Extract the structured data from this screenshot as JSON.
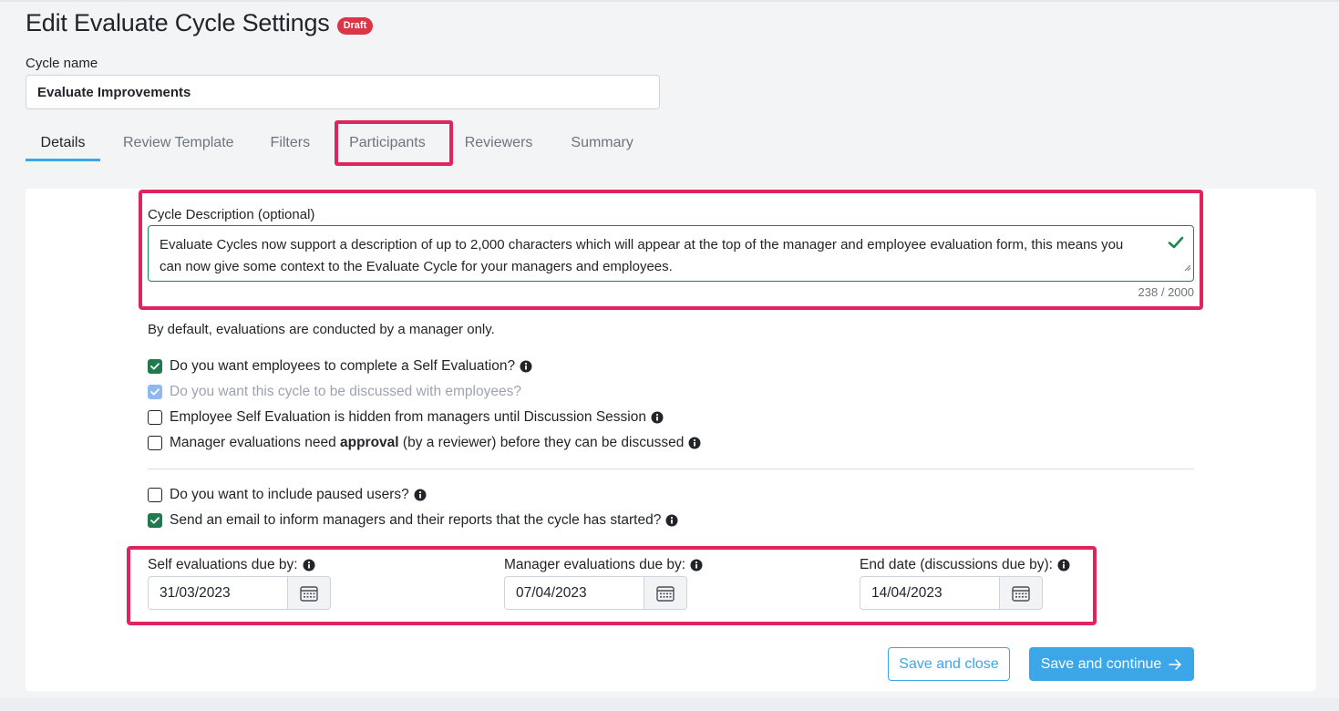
{
  "page": {
    "title": "Edit Evaluate Cycle Settings",
    "status_badge": "Draft"
  },
  "cycle_name": {
    "label": "Cycle name",
    "value": "Evaluate Improvements"
  },
  "tabs": [
    {
      "label": "Details",
      "active": true
    },
    {
      "label": "Review Template",
      "active": false
    },
    {
      "label": "Filters",
      "active": false
    },
    {
      "label": "Participants",
      "active": false,
      "highlighted": true
    },
    {
      "label": "Reviewers",
      "active": false
    },
    {
      "label": "Summary",
      "active": false
    }
  ],
  "description": {
    "label": "Cycle Description (optional)",
    "value": "Evaluate Cycles now support a description of up to 2,000 characters which will appear at the top of the manager and employee evaluation form, this means you can now give some context to the Evaluate Cycle for your managers and employees.",
    "counter": "238 / 2000",
    "valid_icon": "check-icon"
  },
  "intro_text": "By default, evaluations are conducted by a manager only.",
  "options": [
    {
      "label": "Do you want employees to complete a Self Evaluation?",
      "checked": true,
      "disabled": false,
      "info": true
    },
    {
      "label": "Do you want this cycle to be discussed with employees?",
      "checked": true,
      "disabled": true,
      "info": false
    },
    {
      "label": "Employee Self Evaluation is hidden from managers until Discussion Session",
      "checked": false,
      "disabled": false,
      "info": true
    },
    {
      "label_before": "Manager evaluations need ",
      "label_bold": "approval",
      "label_after": " (by a reviewer) before they can be discussed",
      "checked": false,
      "disabled": false,
      "info": true
    }
  ],
  "options2": [
    {
      "label": "Do you want to include paused users?",
      "checked": false,
      "info": true
    },
    {
      "label": "Send an email to inform managers and their reports that the cycle has started?",
      "checked": true,
      "info": true
    }
  ],
  "dates": [
    {
      "label": "Self evaluations due by:",
      "value": "31/03/2023"
    },
    {
      "label": "Manager evaluations due by:",
      "value": "07/04/2023"
    },
    {
      "label": "End date (discussions due by):",
      "value": "14/04/2023"
    }
  ],
  "actions": {
    "save_close": "Save and close",
    "save_continue": "Save and continue"
  },
  "colors": {
    "accent": "#3ba7e8",
    "badge": "#dc3545",
    "highlight": "#e0245e",
    "checked": "#1f7a4d"
  }
}
